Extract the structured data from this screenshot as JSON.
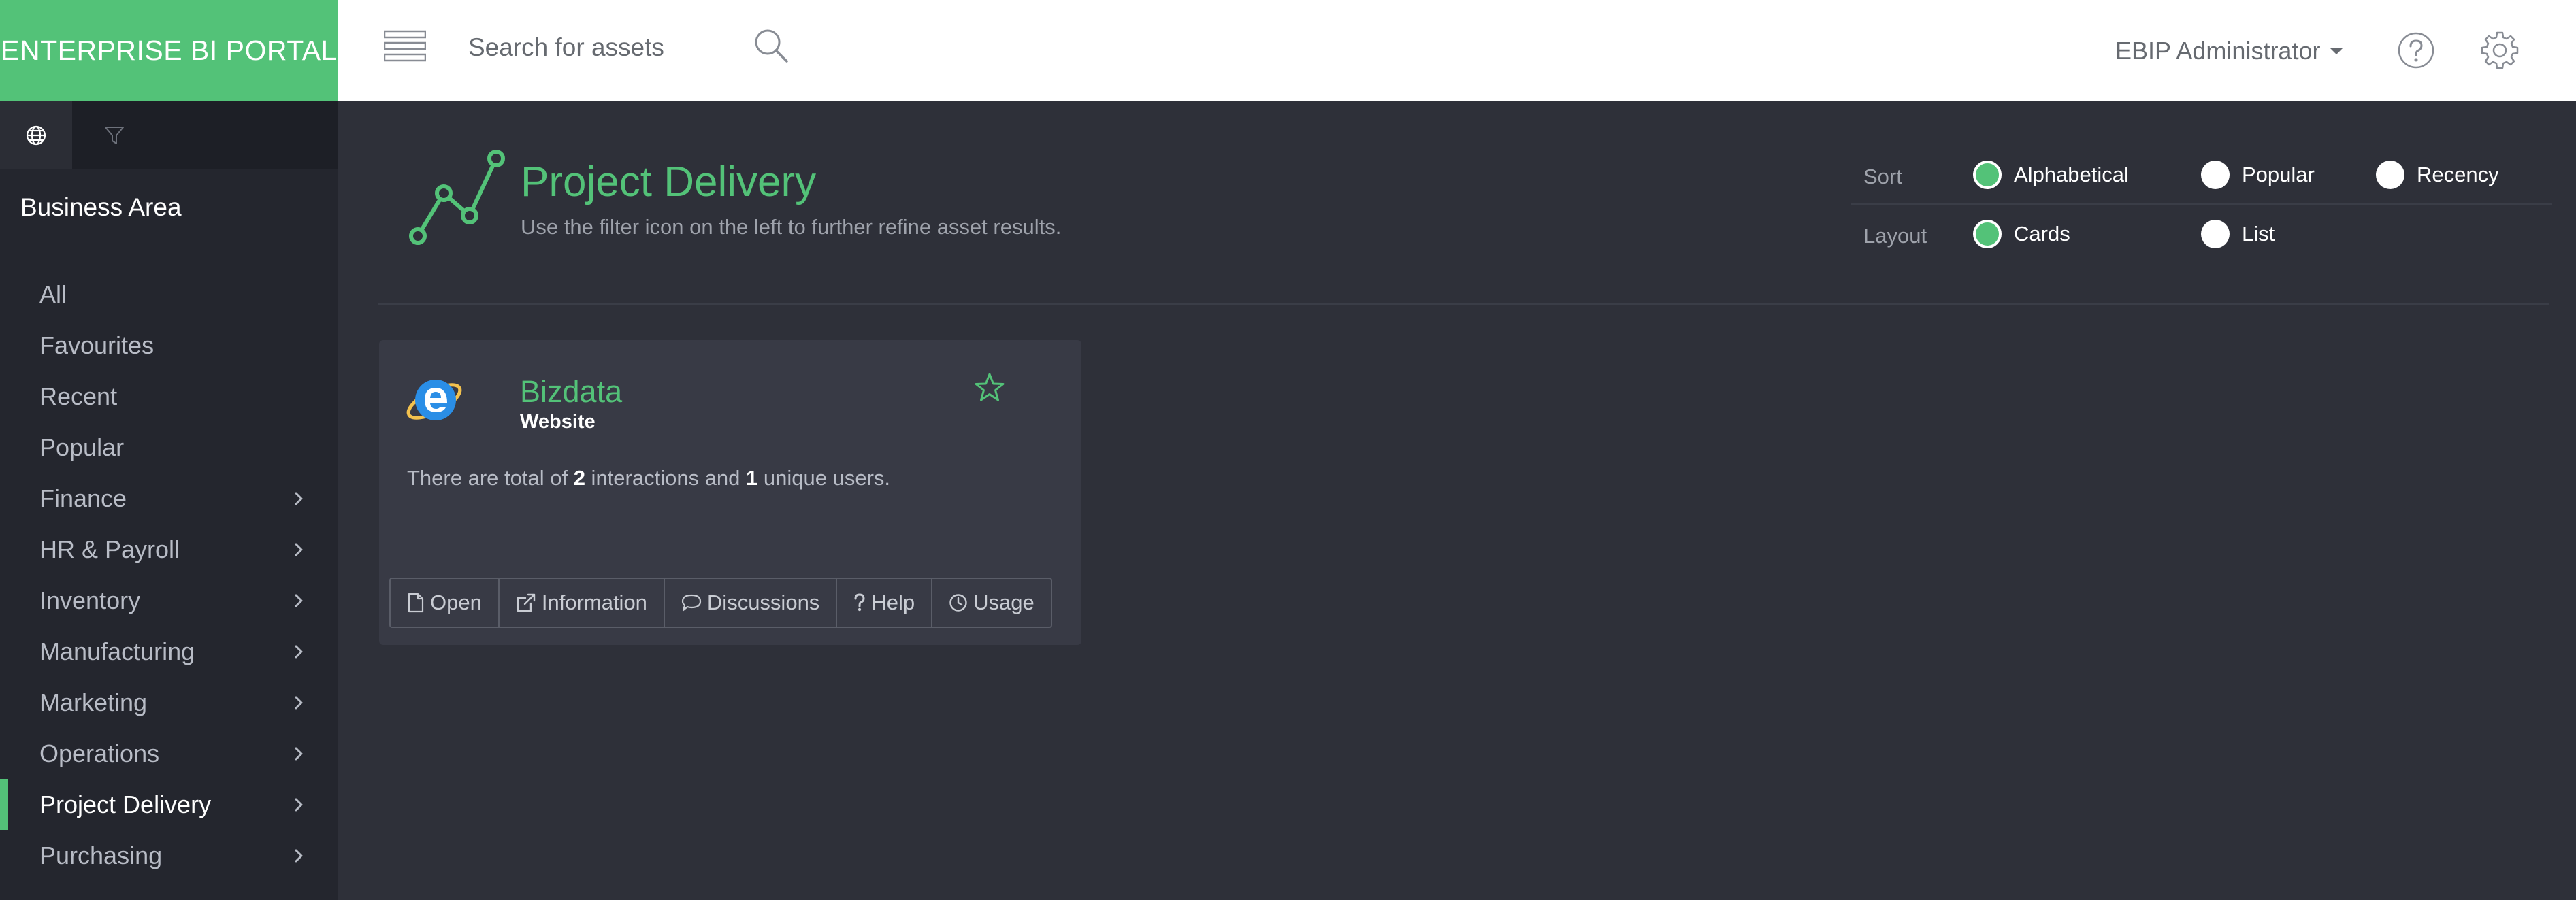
{
  "header": {
    "brand": "ENTERPRISE BI PORTAL",
    "search_placeholder": "Search for assets",
    "user": "EBIP Administrator"
  },
  "sidebar": {
    "heading": "Business Area",
    "items": [
      {
        "label": "All",
        "has_children": false
      },
      {
        "label": "Favourites",
        "has_children": false
      },
      {
        "label": "Recent",
        "has_children": false
      },
      {
        "label": "Popular",
        "has_children": false
      },
      {
        "label": "Finance",
        "has_children": true
      },
      {
        "label": "HR & Payroll",
        "has_children": true
      },
      {
        "label": "Inventory",
        "has_children": true
      },
      {
        "label": "Manufacturing",
        "has_children": true
      },
      {
        "label": "Marketing",
        "has_children": true
      },
      {
        "label": "Operations",
        "has_children": true
      },
      {
        "label": "Project Delivery",
        "has_children": true,
        "active": true
      },
      {
        "label": "Purchasing",
        "has_children": true
      }
    ]
  },
  "page": {
    "title": "Project Delivery",
    "subtitle": "Use the filter icon on the left to further refine asset results."
  },
  "options": {
    "sort_label": "Sort",
    "sort": [
      {
        "label": "Alphabetical",
        "selected": true
      },
      {
        "label": "Popular",
        "selected": false
      },
      {
        "label": "Recency",
        "selected": false
      }
    ],
    "layout_label": "Layout",
    "layout": [
      {
        "label": "Cards",
        "selected": true
      },
      {
        "label": "List",
        "selected": false
      }
    ]
  },
  "card": {
    "title": "Bizdata",
    "type": "Website",
    "stats_prefix": "There are total of ",
    "interactions": "2",
    "stats_middle": " interactions and ",
    "unique_users": "1",
    "stats_suffix": " unique users.",
    "actions": {
      "open": "Open",
      "information": "Information",
      "discussions": "Discussions",
      "help": "Help",
      "usage": "Usage"
    }
  },
  "colors": {
    "accent": "#53c278",
    "background": "#2e3039",
    "sidebar": "#24262e",
    "card": "#383a45"
  }
}
